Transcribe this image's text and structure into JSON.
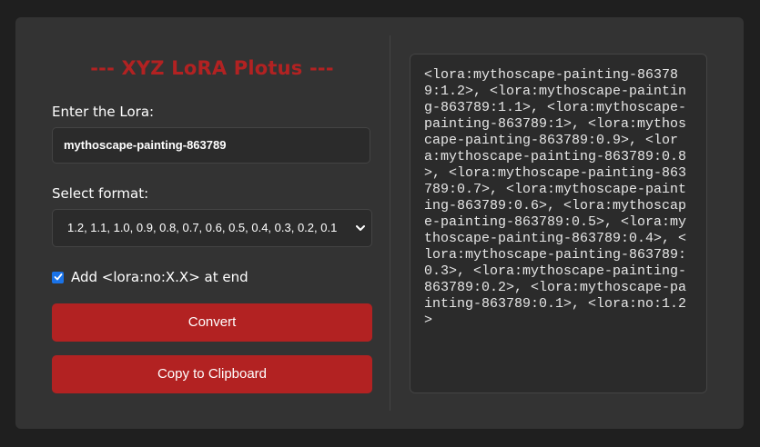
{
  "app": {
    "title": "--- XYZ LoRA Plotus ---"
  },
  "form": {
    "lora_label": "Enter the Lora:",
    "lora_value": "mythoscape-painting-863789",
    "format_label": "Select format:",
    "format_selected": "1.2, 1.1, 1.0, 0.9, 0.8, 0.7, 0.6, 0.5, 0.4, 0.3, 0.2, 0.1",
    "checkbox_checked": true,
    "checkbox_label": "Add <lora:no:X.X> at end",
    "convert_label": "Convert",
    "copy_label": "Copy to Clipboard"
  },
  "output": {
    "text": "<lora:mythoscape-painting-863789:1.2>, <lora:mythoscape-painting-863789:1.1>, <lora:mythoscape-painting-863789:1>, <lora:mythoscape-painting-863789:0.9>, <lora:mythoscape-painting-863789:0.8>, <lora:mythoscape-painting-863789:0.7>, <lora:mythoscape-painting-863789:0.6>, <lora:mythoscape-painting-863789:0.5>, <lora:mythoscape-painting-863789:0.4>, <lora:mythoscape-painting-863789:0.3>, <lora:mythoscape-painting-863789:0.2>, <lora:mythoscape-painting-863789:0.1>, <lora:no:1.2>"
  },
  "colors": {
    "accent": "#b22222",
    "panel": "#333333",
    "background": "#1f1f1f",
    "checkbox": "#1a73e8"
  },
  "icons": {
    "select_arrow": "chevron-down-icon",
    "checkbox_mark": "checkmark-icon"
  }
}
